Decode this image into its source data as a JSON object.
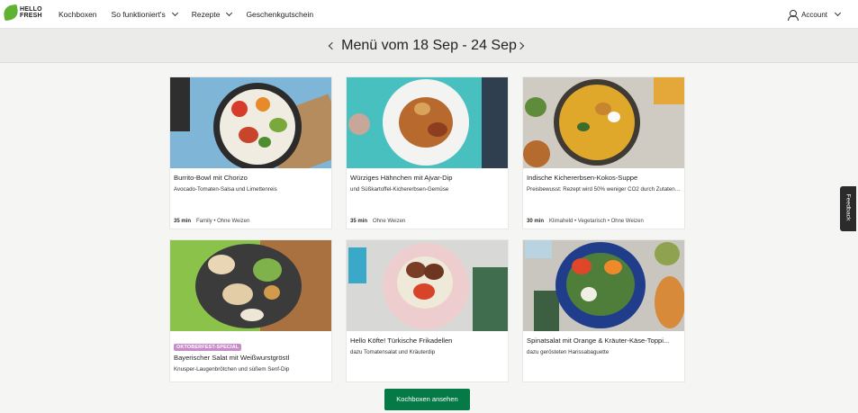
{
  "brand": {
    "logo_text": "HELLO FRESH",
    "accent": "#5fb232"
  },
  "nav": {
    "links": [
      {
        "label": "Kochboxen",
        "has_dropdown": false
      },
      {
        "label": "So funktioniert's",
        "has_dropdown": true
      },
      {
        "label": "Rezepte",
        "has_dropdown": true
      },
      {
        "label": "Geschenkgutschein",
        "has_dropdown": false
      }
    ],
    "account_label": "Account"
  },
  "menu": {
    "title": "Menü vom 18 Sep - 24 Sep",
    "prev_icon": "chevron-left-icon",
    "next_icon": "chevron-right-icon"
  },
  "recipes": [
    {
      "title": "Burrito-Bowl mit Chorizo",
      "subtitle": "Avocado-Tomaten-Salsa und Limettenreis",
      "time": "35 min",
      "tags": "Family • Ohne Weizen",
      "badge": ""
    },
    {
      "title": "Würziges Hähnchen mit Ajvar-Dip",
      "subtitle": "und Süßkartoffel-Kichererbsen-Gemüse",
      "time": "35 min",
      "tags": "Ohne Weizen",
      "badge": ""
    },
    {
      "title": "Indische Kichererbsen-Kokos-Suppe",
      "subtitle": "Preisbewusst: Rezept wird 50% weniger CO2 durch Zutaten ...",
      "time": "30 min",
      "tags": "Klimaheld • Vegetarisch • Ohne Weizen",
      "badge": ""
    },
    {
      "title": "Bayerischer Salat mit Weißwurstgröstl",
      "subtitle": "Knusper-Laugenbrötchen und süßem Senf-Dip",
      "time": "",
      "tags": "",
      "badge": "OKTOBERFEST-SPECIAL"
    },
    {
      "title": "Hello Köfte! Türkische Frikadellen",
      "subtitle": "dazu Tomatensalat und Kräuterdip",
      "time": "",
      "tags": "",
      "badge": ""
    },
    {
      "title": "Spinatsalat mit Orange & Kräuter-Käse-Toppi...",
      "subtitle": "dazu gerösteten Harissabaguette",
      "time": "",
      "tags": "",
      "badge": ""
    }
  ],
  "cta": {
    "label": "Kochboxen ansehen",
    "color": "#067a46"
  },
  "feedback": {
    "label": "Feedback"
  }
}
